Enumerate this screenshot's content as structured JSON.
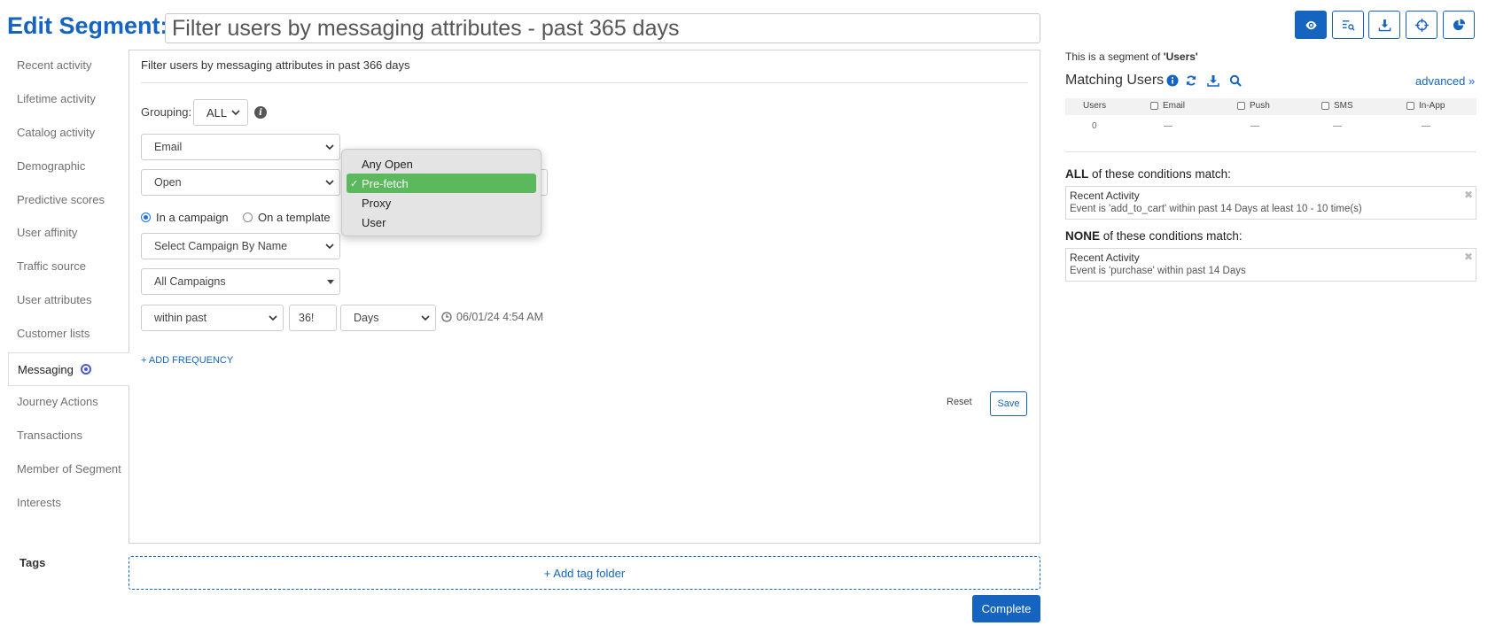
{
  "header": {
    "edit_label": "Edit Segment:",
    "segment_name": "Filter users by messaging attributes - past 365 days"
  },
  "toolbar": {
    "buttons": [
      {
        "icon": "eye-icon",
        "active": true
      },
      {
        "icon": "search-list-icon",
        "active": false
      },
      {
        "icon": "download-icon",
        "active": false
      },
      {
        "icon": "target-icon",
        "active": false
      },
      {
        "icon": "pie-chart-icon",
        "active": false
      }
    ]
  },
  "sidebar": {
    "items": [
      {
        "label": "Recent activity"
      },
      {
        "label": "Lifetime activity"
      },
      {
        "label": "Catalog activity"
      },
      {
        "label": "Demographic"
      },
      {
        "label": "Predictive scores"
      },
      {
        "label": "User affinity"
      },
      {
        "label": "Traffic source"
      },
      {
        "label": "User attributes"
      },
      {
        "label": "Customer lists"
      },
      {
        "label": "Messaging"
      },
      {
        "label": "Journey Actions"
      },
      {
        "label": "Transactions"
      },
      {
        "label": "Member of Segment"
      },
      {
        "label": "Interests"
      }
    ],
    "active_label": "Messaging",
    "tags_label": "Tags"
  },
  "filter": {
    "description": "Filter users by messaging attributes in past 366 days",
    "grouping_label": "Grouping:",
    "grouping_value": "ALL",
    "channel_value": "Email",
    "event_value": "Open",
    "radio_campaign": "In a campaign",
    "radio_template": "On a template",
    "campaign_select": "Select Campaign By Name",
    "all_campaigns": "All Campaigns",
    "time_operator": "within past",
    "time_value": "36!",
    "time_unit": "Days",
    "date": "06/01/24 4:54 AM",
    "add_frequency": "+ ADD FREQUENCY",
    "reset": "Reset",
    "save": "Save"
  },
  "dropdown": {
    "options": [
      "Any Open",
      "Pre-fetch",
      "Proxy",
      "User"
    ],
    "selected": "Pre-fetch"
  },
  "tags": {
    "add_folder": "+ Add tag folder"
  },
  "complete": "Complete",
  "right": {
    "segment_of_prefix": "This is a segment of ",
    "segment_of_value": "'Users'",
    "matching_title": "Matching Users",
    "advanced": "advanced »",
    "columns": [
      "Users",
      "Email",
      "Push",
      "SMS",
      "In-App"
    ],
    "values": [
      "0",
      "—",
      "—",
      "—",
      "—"
    ],
    "all_match_bold": "ALL",
    "all_match_rest": " of these conditions match:",
    "none_match_bold": "NONE",
    "none_match_rest": " of these conditions match:",
    "conditions_all": [
      {
        "name": "Recent Activity",
        "desc": "Event is 'add_to_cart' within past 14 Days at least 10 - 10 time(s)"
      }
    ],
    "conditions_none": [
      {
        "name": "Recent Activity",
        "desc": "Event is 'purchase' within past 14 Days"
      }
    ]
  }
}
